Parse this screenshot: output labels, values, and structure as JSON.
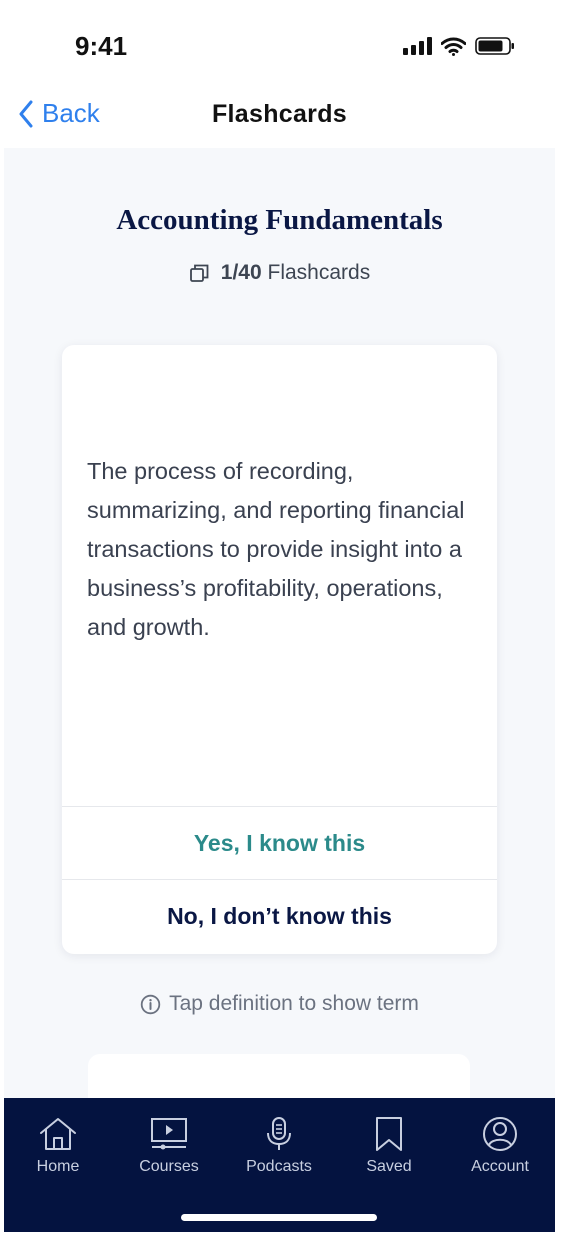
{
  "status_bar": {
    "time": "9:41"
  },
  "nav": {
    "back_label": "Back",
    "title": "Flashcards"
  },
  "deck": {
    "title": "Accounting Fundamentals",
    "progress_count": "1/40",
    "progress_label": "Flashcards"
  },
  "card": {
    "definition": "The process of recording, summarizing, and reporting financial transactions to provide insight into a business’s profitability, operations, and growth.",
    "yes_label": "Yes, I know this",
    "no_label": "No, I don’t know this"
  },
  "hint": "Tap definition to show term",
  "tabs": [
    {
      "label": "Home",
      "icon": "home-icon"
    },
    {
      "label": "Courses",
      "icon": "play-screen-icon"
    },
    {
      "label": "Podcasts",
      "icon": "microphone-icon"
    },
    {
      "label": "Saved",
      "icon": "bookmark-icon"
    },
    {
      "label": "Account",
      "icon": "user-circle-icon"
    }
  ],
  "colors": {
    "accent_blue": "#2f80ed",
    "navy": "#0a1744",
    "teal": "#2b8a8a",
    "tab_bar": "#041340",
    "background": "#f6f8fb"
  }
}
